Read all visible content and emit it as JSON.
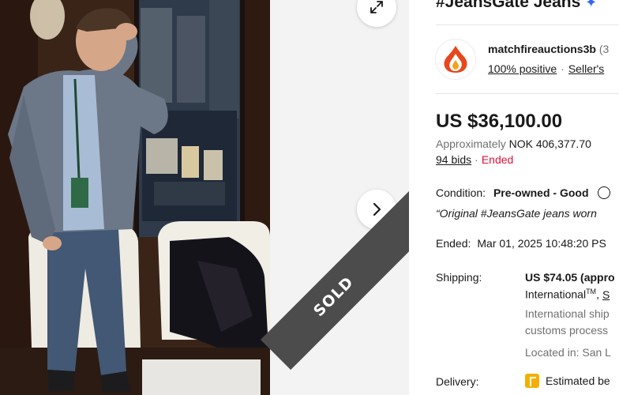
{
  "listing": {
    "title": "#JeansGate Jeans",
    "title_badge_icon": "sparkle-icon",
    "sold_ribbon": "SOLD"
  },
  "seller": {
    "name": "matchfireauctions3b",
    "count": "(3",
    "feedback": "100% positive",
    "other_link": "Seller's",
    "logo_icon": "flame-icon",
    "logo_color": "#e8471d"
  },
  "pricing": {
    "price": "US $36,100.00",
    "approx_prefix": "Approximately",
    "approx_value": "NOK 406,377.70",
    "bids": "94 bids",
    "status": "Ended",
    "status_color": "#e0103a"
  },
  "condition": {
    "label": "Condition:",
    "value": "Pre-owned - Good",
    "quote": "“Original #JeansGate jeans worn"
  },
  "ended": {
    "label": "Ended:",
    "value": "Mar 01, 2025 10:48:20 PS"
  },
  "shipping": {
    "label": "Shipping:",
    "cost": "US $74.05 (appro",
    "type": "International",
    "type_sup": "TM",
    "type_suffix": ",",
    "see_link": "S",
    "note_line1": "International ship",
    "note_line2": "customs process",
    "location": "Located in: San L"
  },
  "delivery": {
    "label": "Delivery:",
    "value": "Estimated be",
    "icon": "calendar-icon"
  },
  "gallery": {
    "expand_icon": "expand-icon",
    "next_icon": "chevron-right-icon"
  }
}
